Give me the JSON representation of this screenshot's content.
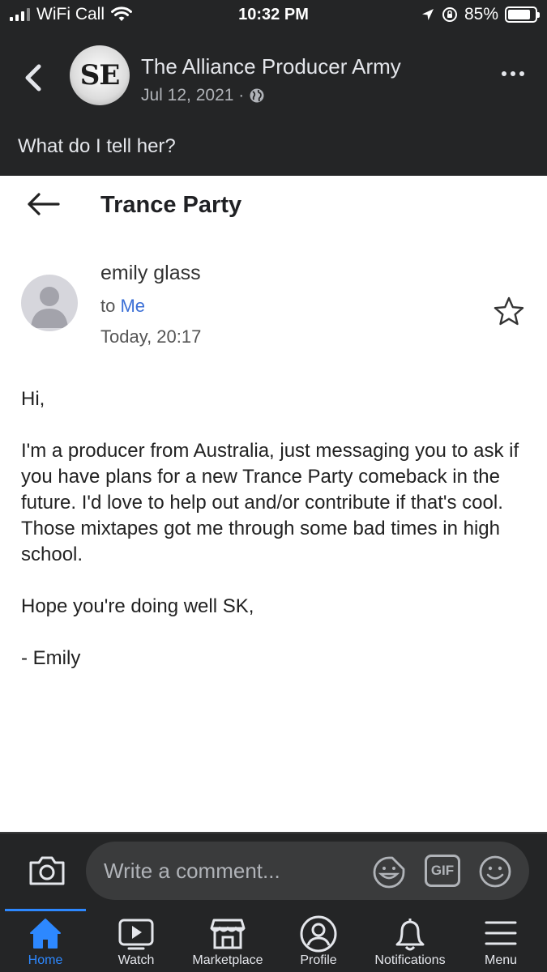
{
  "status_bar": {
    "carrier": "WiFi Call",
    "time": "10:32 PM",
    "battery_percent": "85%",
    "battery_level": 0.85
  },
  "post": {
    "group_avatar_text": "SE",
    "group_name": "The Alliance Producer Army",
    "date": "Jul 12, 2021 ·",
    "caption": "What do I tell her?"
  },
  "email": {
    "subject": "Trance Party",
    "sender": "emily glass",
    "to_prefix": "to",
    "to_name": "Me",
    "date": "Today, 20:17",
    "body": [
      "Hi,",
      "I'm a producer from Australia, just messaging you to ask if you have plans for a new Trance Party comeback in the future. I'd love to help out and/or contribute if that's cool. Those mixtapes got me through some bad times in high school.",
      "Hope you're doing well SK,",
      "- Emily"
    ]
  },
  "comment": {
    "placeholder": "Write a comment...",
    "gif_label": "GIF"
  },
  "tabs": [
    {
      "label": "Home",
      "icon": "home-icon",
      "active": true
    },
    {
      "label": "Watch",
      "icon": "watch-icon",
      "active": false
    },
    {
      "label": "Marketplace",
      "icon": "marketplace-icon",
      "active": false
    },
    {
      "label": "Profile",
      "icon": "profile-icon",
      "active": false
    },
    {
      "label": "Notifications",
      "icon": "bell-icon",
      "active": false
    },
    {
      "label": "Menu",
      "icon": "menu-icon",
      "active": false
    }
  ],
  "colors": {
    "background": "#242526",
    "accent": "#2d88ff",
    "link_blue": "#3b6fd6"
  }
}
